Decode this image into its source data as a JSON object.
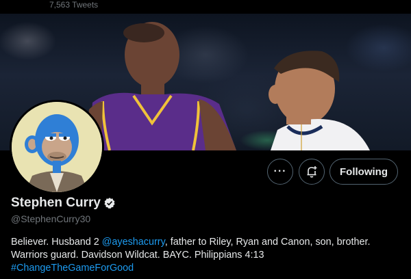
{
  "header": {
    "tweet_count": "7,563 Tweets"
  },
  "actions": {
    "more_label": "···",
    "following_label": "Following"
  },
  "profile": {
    "display_name": "Stephen Curry",
    "handle": "@StephenCurry30",
    "bio": {
      "line1_prefix": "Believer. Husband 2 ",
      "mention": "@ayeshacurry",
      "line1_suffix": ", father to Riley, Ryan and Canon, son, brother.",
      "line2": "Warriors guard. Davidson Wildcat. BAYC. Philippians 4:13",
      "hashtag": "#ChangeTheGameForGood"
    }
  },
  "colors": {
    "link": "#1d9bf0",
    "verified": "#e7e9ea",
    "background": "#000000",
    "ape_fur": "#2f7fd6",
    "avatar_bg": "#e9e3b2"
  },
  "icons": {
    "verified": "verified-badge-icon",
    "notify": "bell-plus-icon",
    "more": "more-icon"
  }
}
